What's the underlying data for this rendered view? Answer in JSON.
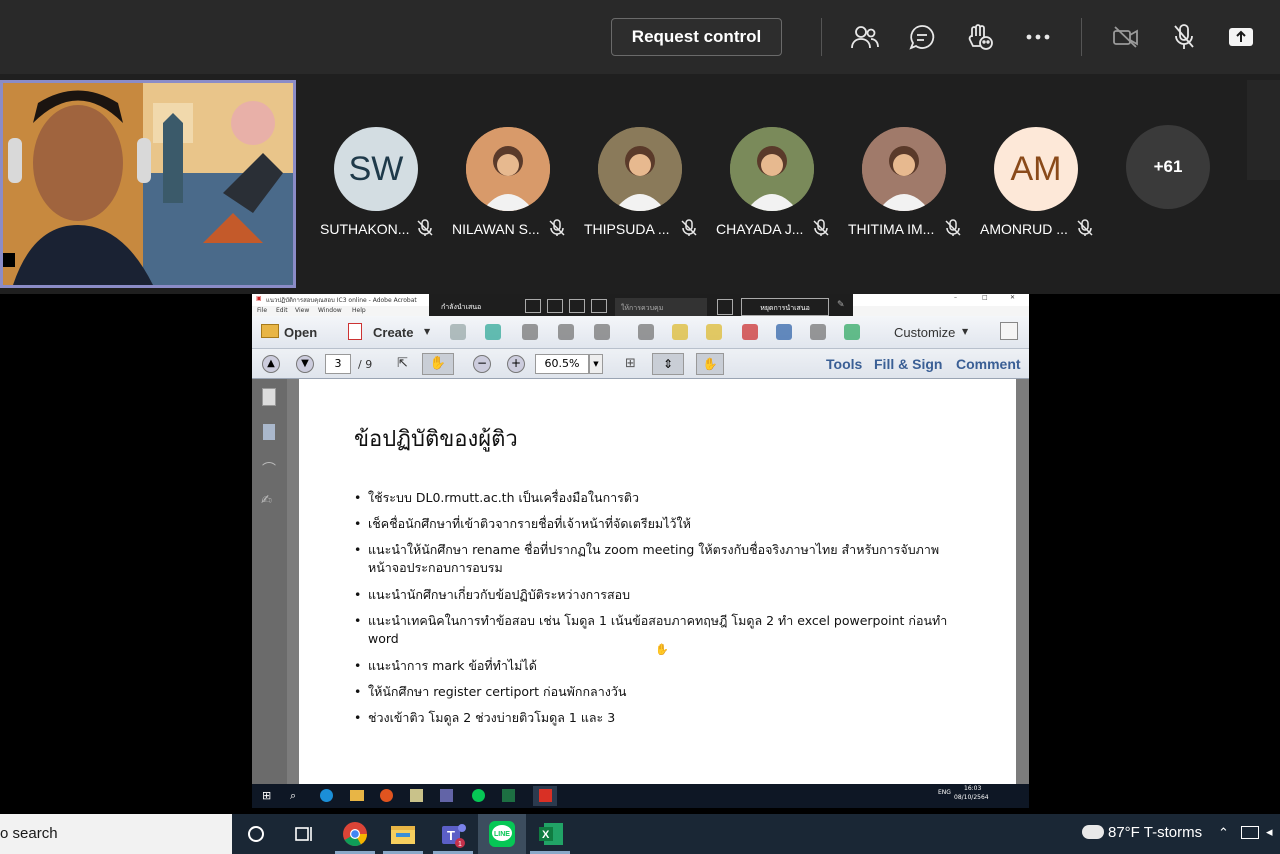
{
  "topbar": {
    "request_control_label": "Request control",
    "icons": [
      "people-icon",
      "chat-icon",
      "raise-hand-icon",
      "more-icon",
      "camera-off-icon",
      "mic-off-icon",
      "share-icon"
    ]
  },
  "participants": [
    {
      "name": "SUTHAKON...",
      "initials": "SW",
      "bg": "#d3dde2",
      "fg": "#1f3a4a"
    },
    {
      "name": "NILAWAN S...",
      "initials": "",
      "bg": "#d89a6a",
      "fg": "#fff"
    },
    {
      "name": "THIPSUDA ...",
      "initials": "",
      "bg": "#8a7a5a",
      "fg": "#fff"
    },
    {
      "name": "CHAYADA J...",
      "initials": "",
      "bg": "#7a8a5a",
      "fg": "#fff"
    },
    {
      "name": "THITIMA IM...",
      "initials": "",
      "bg": "#a07a6a",
      "fg": "#fff"
    },
    {
      "name": "AMONRUD ...",
      "initials": "AM",
      "bg": "#fde8d8",
      "fg": "#8a4a1a"
    }
  ],
  "more_participants": "+61",
  "acrobat": {
    "window_title": "แนวปฏิบัติการสอบคุณสอบ IC3 online - Adobe Acrobat",
    "menu": [
      "File",
      "Edit",
      "View",
      "Window",
      "Help"
    ],
    "share_status": "กำลังนำเสนอ",
    "share_control": "ให้การควบคุม",
    "stop_share": "หยุดการนำเสนอ",
    "open_label": "Open",
    "create_label": "Create",
    "customize_label": "Customize",
    "page_current": "3",
    "page_total": "/ 9",
    "zoom": "60.5%",
    "tools_label": "Tools",
    "fill_sign_label": "Fill & Sign",
    "comment_label": "Comment"
  },
  "document": {
    "title": "ข้อปฏิบัติของผู้ติว",
    "bullets": [
      "ใช้ระบบ DL0.rmutt.ac.th เป็นเครื่องมือในการติว",
      "เช็คชื่อนักศึกษาที่เข้าติวจากรายชื่อที่เจ้าหน้าที่จัดเตรียมไว้ให้",
      "แนะนำให้นักศึกษา rename ชื่อที่ปรากฏใน zoom meeting ให้ตรงกับชื่อจริงภาษาไทย สำหรับการจับภาพหน้าจอประกอบการอบรม",
      "แนะนำนักศึกษาเกี่ยวกับข้อปฏิบัติระหว่างการสอบ",
      "แนะนำเทคนิคในการทำข้อสอบ เช่น โมดูล 1 เน้นข้อสอบภาคทฤษฎี โมดูล 2 ทำ excel powerpoint ก่อนทำ word",
      "แนะนำการ mark ข้อที่ทำไม่ได้",
      "ให้นักศึกษา register certiport ก่อนพักกลางวัน",
      "ช่วงเข้าติว โมดูล 2 ช่วงบ่ายติวโมดูล 1 และ 3"
    ]
  },
  "inner_taskbar": {
    "time": "16:03",
    "date": "08/10/2564",
    "lang": "ENG"
  },
  "taskbar": {
    "search_text": "o search",
    "weather": "87°F  T-storms"
  }
}
